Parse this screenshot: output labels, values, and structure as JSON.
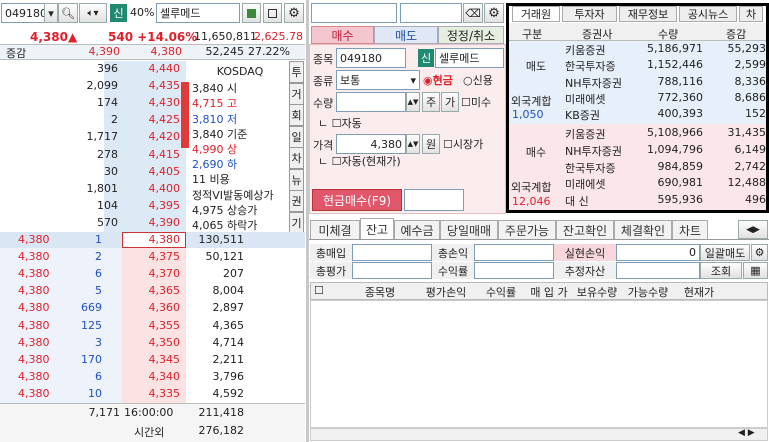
{
  "left": {
    "code": "049180",
    "pct": "40%",
    "name": "셀루메드",
    "shin": "신",
    "price": "4,380",
    "arrow": "▲",
    "change": "540",
    "change_pct": "+14.06%",
    "volume": "11,650,811",
    "vol_pct": "2,625.78",
    "hdr_label": "증감",
    "hdr_ask": "4,390",
    "hdr_price": "4,380",
    "hdr_vol": "52,245",
    "hdr_ratio": "27.22%",
    "asks": [
      {
        "q": "396",
        "p": "4,440"
      },
      {
        "q": "2,099",
        "p": "4,435"
      },
      {
        "q": "174",
        "p": "4,430"
      },
      {
        "q": "2",
        "p": "4,425"
      },
      {
        "q": "1,717",
        "p": "4,420"
      },
      {
        "q": "278",
        "p": "4,415"
      },
      {
        "q": "30",
        "p": "4,405"
      },
      {
        "q": "1,801",
        "p": "4,400"
      },
      {
        "q": "104",
        "p": "4,395"
      },
      {
        "q": "570",
        "p": "4,390"
      }
    ],
    "info": [
      {
        "l": "",
        "v": "KOSDAQ",
        "c": ""
      },
      {
        "l": "시",
        "v": "3,840",
        "c": ""
      },
      {
        "l": "고",
        "v": "4,715",
        "c": "red"
      },
      {
        "l": "저",
        "v": "3,810",
        "c": "blue"
      },
      {
        "l": "기준",
        "v": "3,840",
        "c": ""
      },
      {
        "l": "상",
        "v": "4,990",
        "c": "red"
      },
      {
        "l": "하",
        "v": "2,690",
        "c": "blue"
      },
      {
        "l": "비용",
        "v": "11",
        "c": ""
      },
      {
        "l": "정적VI발동예상가",
        "v": "",
        "c": ""
      },
      {
        "l": "상승가",
        "v": "4,975",
        "c": ""
      },
      {
        "l": "하락가",
        "v": "4,065",
        "c": ""
      }
    ],
    "vtabs": [
      "투",
      "거",
      "회",
      "일",
      "차",
      "뉴",
      "권",
      "기"
    ],
    "bids": [
      {
        "a": "4,380",
        "q": "1",
        "p": "4,380",
        "v": "130,511"
      },
      {
        "a": "4,380",
        "q": "2",
        "p": "4,375",
        "v": "50,121"
      },
      {
        "a": "4,380",
        "q": "6",
        "p": "4,370",
        "v": "207"
      },
      {
        "a": "4,380",
        "q": "5",
        "p": "4,365",
        "v": "8,004"
      },
      {
        "a": "4,380",
        "q": "669",
        "p": "4,360",
        "v": "2,897"
      },
      {
        "a": "4,380",
        "q": "125",
        "p": "4,355",
        "v": "4,365"
      },
      {
        "a": "4,380",
        "q": "3",
        "p": "4,350",
        "v": "4,714"
      },
      {
        "a": "4,380",
        "q": "170",
        "p": "4,345",
        "v": "2,211"
      },
      {
        "a": "4,380",
        "q": "6",
        "p": "4,340",
        "v": "3,796"
      },
      {
        "a": "4,380",
        "q": "10",
        "p": "4,335",
        "v": "4,592"
      }
    ],
    "foot": {
      "total": "7,171",
      "time": "16:00:00",
      "vol": "211,418",
      "after_label": "시간외",
      "after_vol": "276,182"
    }
  },
  "order": {
    "tab_buy": "매수",
    "tab_sell": "매도",
    "tab_mod": "정정/취소",
    "lbl_code": "종목",
    "code": "049180",
    "shin": "신",
    "name": "셀루메드",
    "lbl_type": "종류",
    "type": "보통",
    "cash": "현금",
    "credit": "신용",
    "lbl_qty": "수량",
    "ju": "주",
    "ga": "가",
    "misu": "미수",
    "auto": "자동",
    "lbl_price": "가격",
    "price": "4,380",
    "won": "원",
    "market": "시장가",
    "auto2": "자동(현재가)",
    "submit": "현금매수(F9)"
  },
  "broker": {
    "tabs": [
      "거래원",
      "투자자",
      "재무정보",
      "공시뉴스",
      "차"
    ],
    "cols": [
      "구분",
      "증권사",
      "수량",
      "증감"
    ],
    "sell_label": "매도",
    "buy_label": "매수",
    "sell": [
      {
        "n": "키움증권",
        "q": "5,186,971",
        "d": "55,293"
      },
      {
        "n": "한국투자증",
        "q": "1,152,446",
        "d": "2,599"
      },
      {
        "n": "NH투자증권",
        "q": "788,116",
        "d": "8,336"
      },
      {
        "n": "미래에셋",
        "q": "772,360",
        "d": "8,686"
      },
      {
        "n": "KB증권",
        "q": "400,393",
        "d": "152"
      }
    ],
    "sell_foreign": "외국계합",
    "sell_foreign_val": "1,050",
    "buy": [
      {
        "n": "키움증권",
        "q": "5,108,966",
        "d": "31,435"
      },
      {
        "n": "NH투자증권",
        "q": "1,094,796",
        "d": "6,149"
      },
      {
        "n": "한국투자증",
        "q": "984,859",
        "d": "2,742"
      },
      {
        "n": "미래에셋",
        "q": "690,981",
        "d": "12,488"
      },
      {
        "n": "대 신",
        "q": "595,936",
        "d": "496"
      }
    ],
    "buy_foreign": "외국계합",
    "buy_foreign_val": "12,046"
  },
  "bottom": {
    "tabs": [
      "미체결",
      "잔고",
      "예수금",
      "당일매매",
      "주문가능",
      "잔고확인",
      "체결확인",
      "차트"
    ],
    "s1": "총매입",
    "s2": "총손익",
    "s3": "실현손익",
    "s3v": "0",
    "s4": "일괄매도",
    "s5": "총평가",
    "s6": "수익률",
    "s7": "추정자산",
    "s8": "조회",
    "cols": [
      "종목명",
      "평가손익",
      "수익률",
      "매 입 가",
      "보유수량",
      "가능수량",
      "현재가"
    ]
  }
}
